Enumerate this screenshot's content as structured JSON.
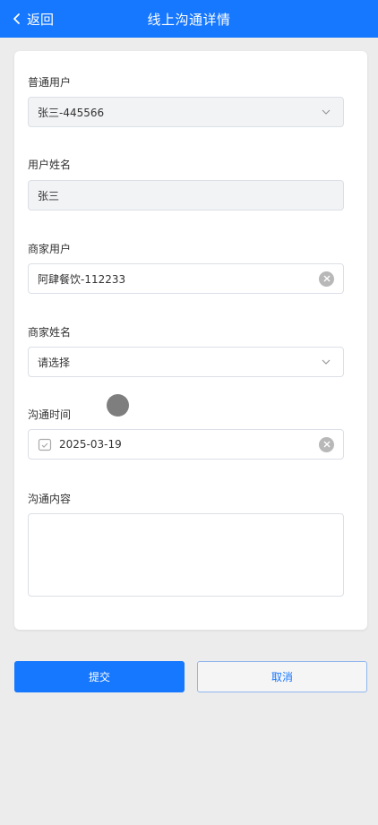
{
  "header": {
    "back_label": "返回",
    "title": "线上沟通详情",
    "background": "#1677ff"
  },
  "form": {
    "ordinary_user": {
      "label": "普通用户",
      "value": "张三-445566",
      "icon": "chevron-down-icon"
    },
    "user_name": {
      "label": "用户姓名",
      "value": "张三"
    },
    "merchant_user": {
      "label": "商家用户",
      "value": "阿肆餐饮-112233",
      "icon": "clear-icon"
    },
    "merchant_name": {
      "label": "商家姓名",
      "placeholder": "请选择",
      "icon": "chevron-down-icon"
    },
    "comm_time": {
      "label": "沟通时间",
      "value": "2025-03-19",
      "icon": "calendar-icon"
    },
    "comm_content": {
      "label": "沟通内容",
      "value": ""
    }
  },
  "actions": {
    "submit_label": "提交",
    "cancel_label": "取消"
  }
}
